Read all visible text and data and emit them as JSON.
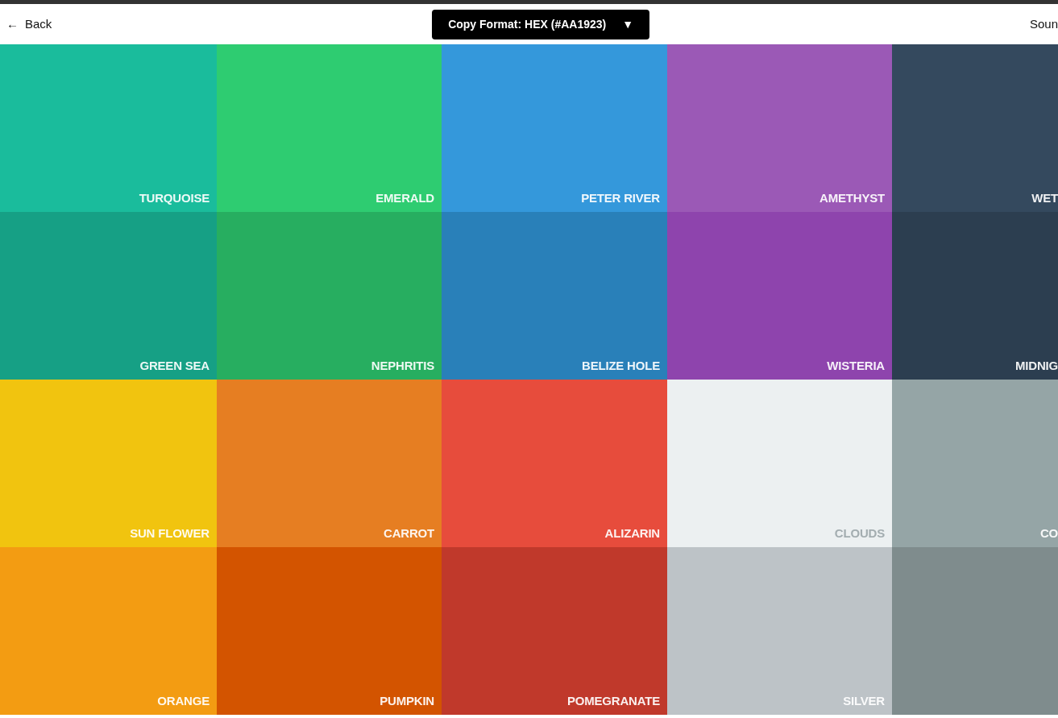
{
  "header": {
    "back": {
      "icon": "←",
      "label": "Back"
    },
    "format_button": {
      "label": "Copy Format: HEX (#AA1923)",
      "caret": "▼"
    },
    "sound": {
      "label": "Soun"
    }
  },
  "swatches": [
    {
      "name": "TURQUOISE",
      "color": "#1abc9c"
    },
    {
      "name": "EMERALD",
      "color": "#2ecc71"
    },
    {
      "name": "PETER RIVER",
      "color": "#3498db"
    },
    {
      "name": "AMETHYST",
      "color": "#9b59b6"
    },
    {
      "name": "WET",
      "color": "#34495e"
    },
    {
      "name": "GREEN SEA",
      "color": "#16a085"
    },
    {
      "name": "NEPHRITIS",
      "color": "#27ae60"
    },
    {
      "name": "BELIZE HOLE",
      "color": "#2980b9"
    },
    {
      "name": "WISTERIA",
      "color": "#8e44ad"
    },
    {
      "name": "MIDNIG",
      "color": "#2c3e50"
    },
    {
      "name": "SUN FLOWER",
      "color": "#f1c40f"
    },
    {
      "name": "CARROT",
      "color": "#e67e22"
    },
    {
      "name": "ALIZARIN",
      "color": "#e74c3c"
    },
    {
      "name": "CLOUDS",
      "color": "#ecf0f1"
    },
    {
      "name": "CO",
      "color": "#95a5a6"
    },
    {
      "name": "ORANGE",
      "color": "#f39c12"
    },
    {
      "name": "PUMPKIN",
      "color": "#d35400"
    },
    {
      "name": "POMEGRANATE",
      "color": "#c0392b"
    },
    {
      "name": "SILVER",
      "color": "#bdc3c7"
    },
    {
      "color": "#7f8c8d"
    }
  ]
}
